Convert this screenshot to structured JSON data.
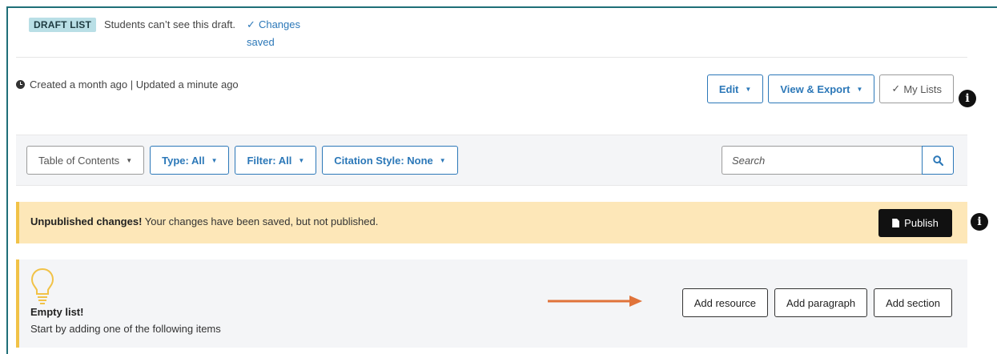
{
  "status": {
    "badge": "DRAFT LIST",
    "note": "Students can’t see this draft.",
    "saved_check": "✓",
    "saved": "Changes saved"
  },
  "meta": {
    "created": "Created a month ago | Updated a minute ago"
  },
  "actions": {
    "edit": "Edit",
    "view_export": "View & Export",
    "my_lists_check": "✓",
    "my_lists": "My Lists",
    "info": "i"
  },
  "toolbar": {
    "toc": "Table of Contents",
    "type": "Type: All",
    "filter": "Filter: All",
    "citation": "Citation Style: None",
    "search_placeholder": "Search"
  },
  "banner": {
    "title": "Unpublished changes!",
    "message": "Your changes have been saved, but not published.",
    "publish": "Publish",
    "info": "i"
  },
  "empty": {
    "title": "Empty list!",
    "subtitle": "Start by adding one of the following items",
    "add_resource": "Add resource",
    "add_paragraph": "Add paragraph",
    "add_section": "Add section"
  },
  "colors": {
    "accent": "#2c78b8",
    "border": "#1f6f78",
    "badge_bg": "#b9dfe6",
    "warning_bg": "#fde7b8",
    "warning_bar": "#f1c247",
    "arrow": "#e0733a"
  },
  "icons": [
    "clock-icon",
    "caret-down-icon",
    "check-icon",
    "info-icon",
    "search-icon",
    "document-icon",
    "lightbulb-icon",
    "arrow-right-icon"
  ]
}
